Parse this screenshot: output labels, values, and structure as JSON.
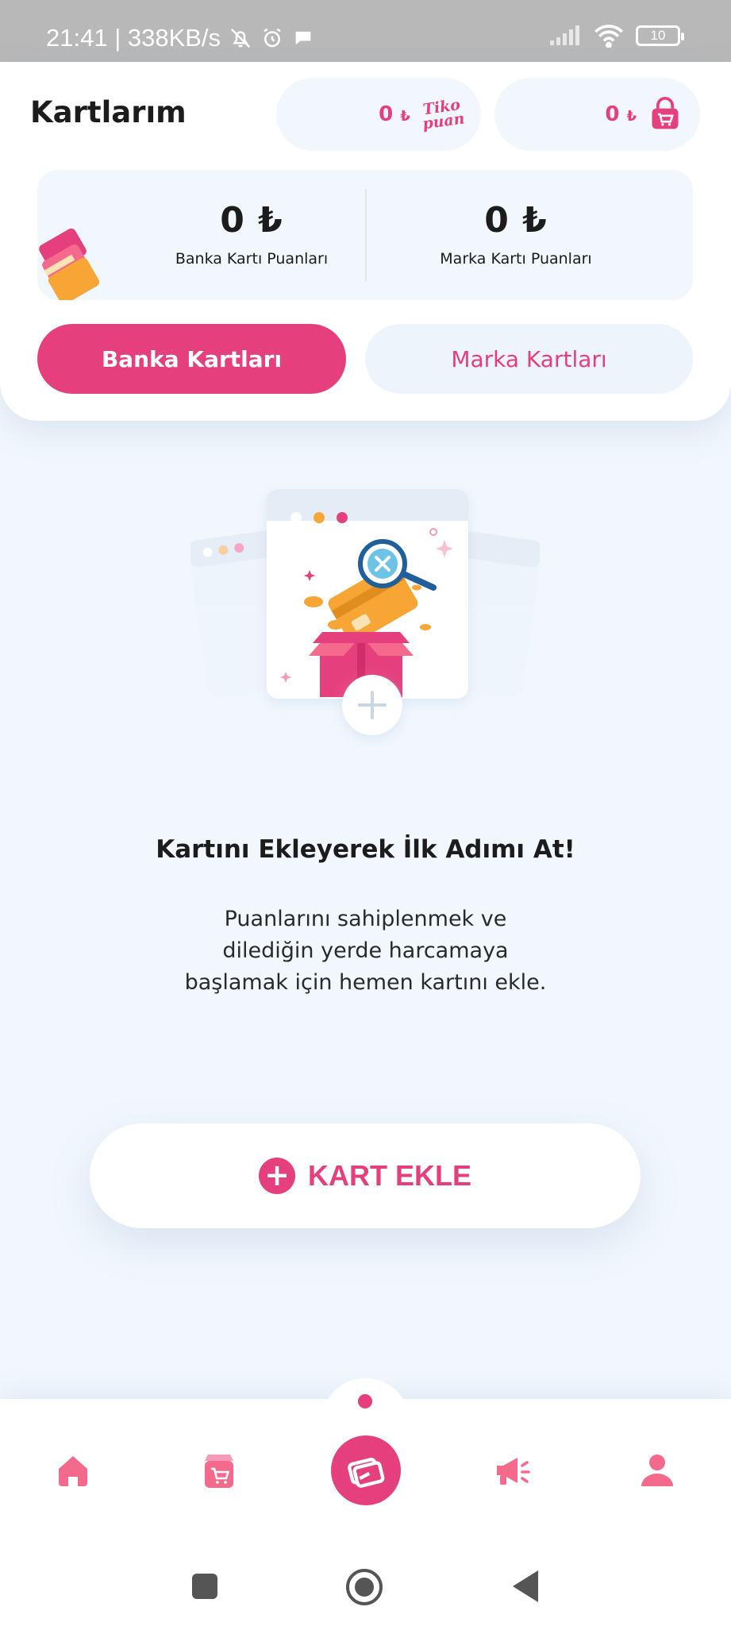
{
  "status_bar": {
    "time_speed": "21:41 | 338KB/s",
    "battery": "10"
  },
  "header": {
    "title": "Kartlarım",
    "tiko_points": "0",
    "tiko_currency": "₺",
    "tiko_logo_line1": "Tiko",
    "tiko_logo_line2": "puan",
    "cart_points": "0",
    "cart_currency": "₺"
  },
  "points": {
    "bank_amount": "0 ₺",
    "bank_label": "Banka Kartı Puanları",
    "brand_amount": "0 ₺",
    "brand_label": "Marka Kartı Puanları"
  },
  "tabs": {
    "bank": "Banka Kartları",
    "brand": "Marka Kartları"
  },
  "empty_state": {
    "title": "Kartını Ekleyerek İlk Adımı At!",
    "description": "Puanlarını sahiplenmek ve dilediğin yerde harcamaya başlamak için hemen kartını ekle.",
    "add_button": "KART EKLE"
  },
  "bottom_nav": {
    "items": [
      "home-icon",
      "shop-icon",
      "cards-icon",
      "campaign-icon",
      "profile-icon"
    ],
    "active": "cards-icon"
  },
  "colors": {
    "accent": "#e63f7e",
    "background": "#f1f7fd",
    "orange": "#f7a534"
  }
}
